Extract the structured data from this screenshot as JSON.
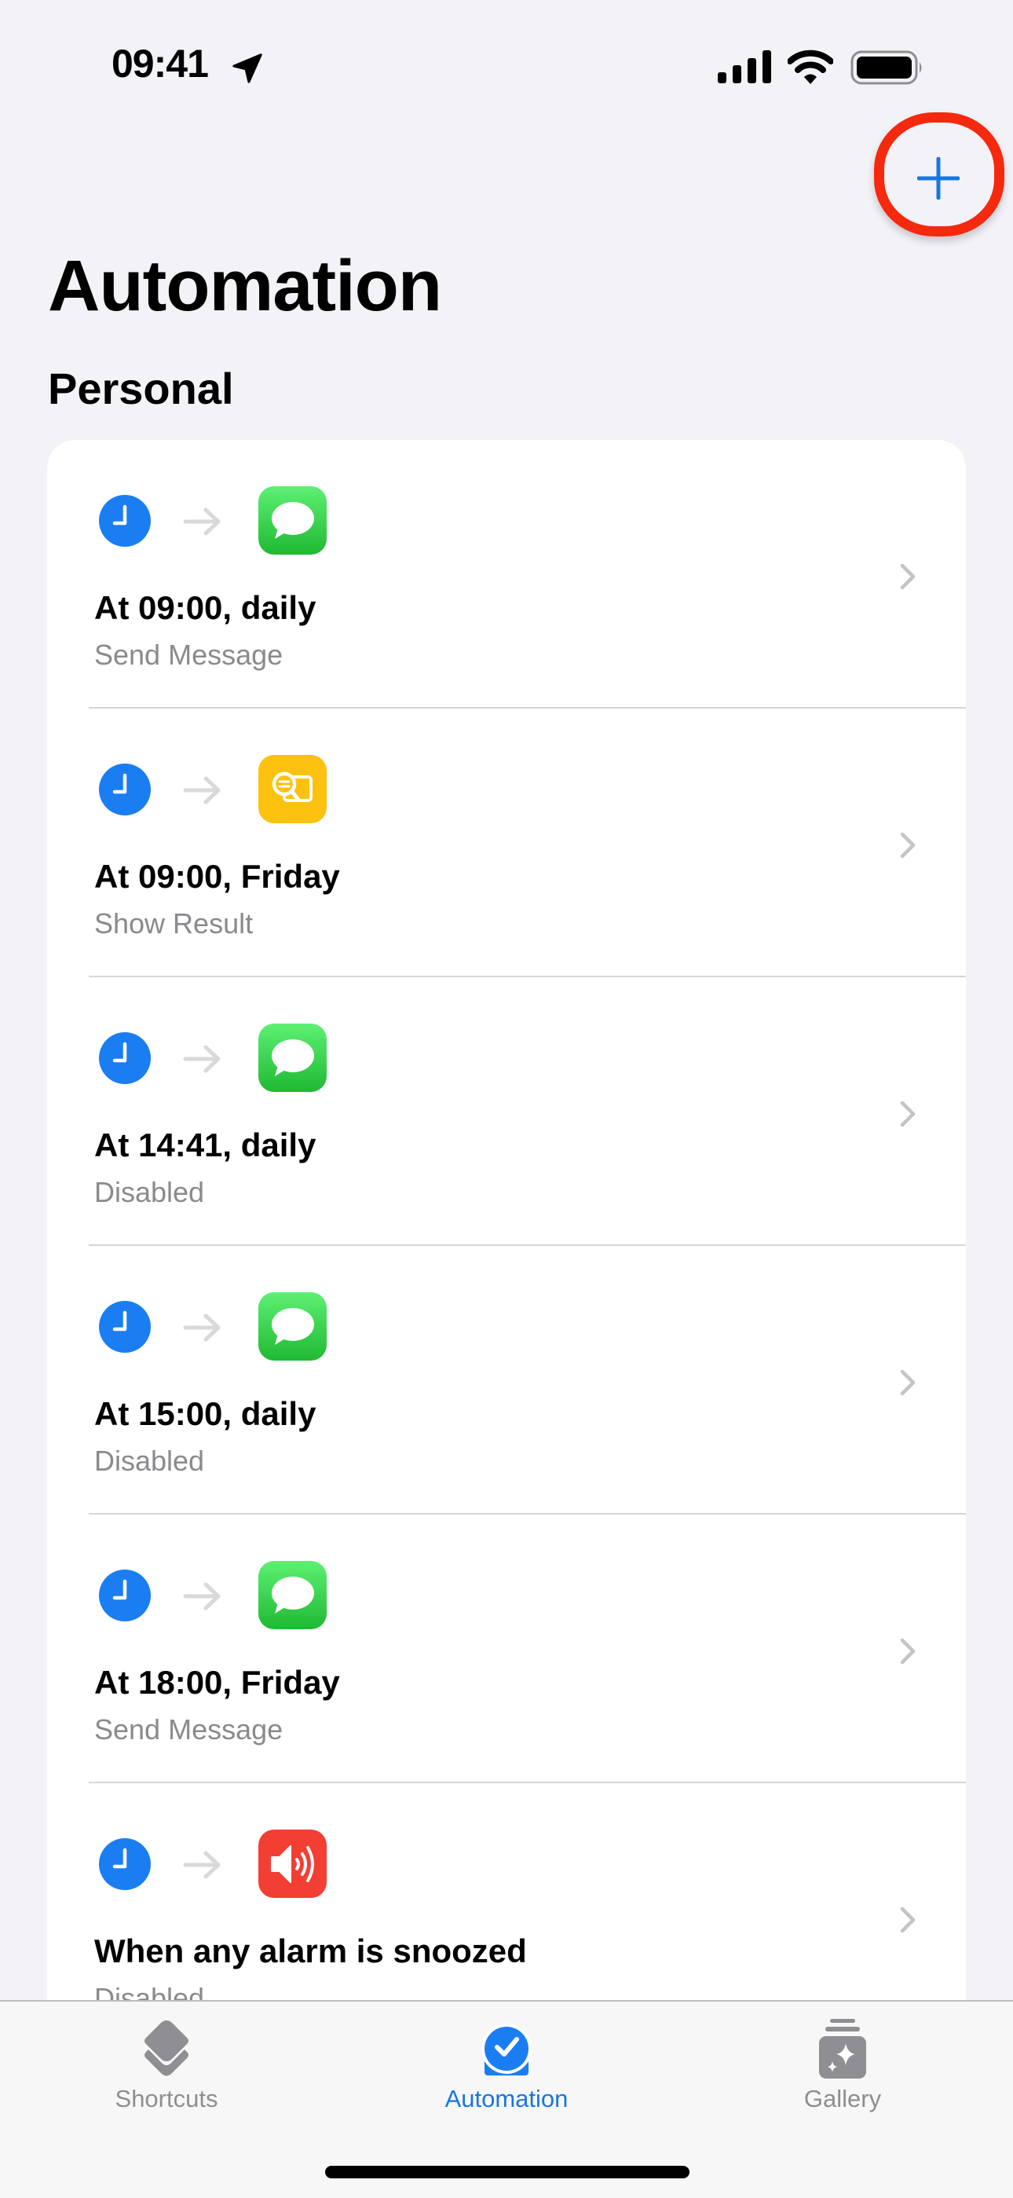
{
  "status_bar": {
    "time": "09:41",
    "icons": [
      "location-arrow-icon",
      "cellular-signal-icon",
      "wifi-icon",
      "battery-icon"
    ]
  },
  "nav": {
    "add_button_icon": "plus-icon",
    "annotation": "red-circle-highlight"
  },
  "page": {
    "title": "Automation",
    "section_title": "Personal"
  },
  "colors": {
    "accent": "#1976E0",
    "clock_blue": "#1A7EF2",
    "messages_green": "#34C759",
    "show_result_yellow": "#FDC20F",
    "sound_red": "#F33E33",
    "annotation_red": "#F5290E",
    "background": "#F2F2F7"
  },
  "automations": [
    {
      "title": "At 09:00, daily",
      "subtitle": "Send Message",
      "trigger_icon": "clock-icon",
      "action_icon": "messages-icon"
    },
    {
      "title": "At 09:00, Friday",
      "subtitle": "Show Result",
      "trigger_icon": "clock-icon",
      "action_icon": "show-result-icon"
    },
    {
      "title": "At 14:41, daily",
      "subtitle": "Disabled",
      "trigger_icon": "clock-icon",
      "action_icon": "messages-icon"
    },
    {
      "title": "At 15:00, daily",
      "subtitle": "Disabled",
      "trigger_icon": "clock-icon",
      "action_icon": "messages-icon"
    },
    {
      "title": "At 18:00, Friday",
      "subtitle": "Send Message",
      "trigger_icon": "clock-icon",
      "action_icon": "messages-icon"
    },
    {
      "title": "When any alarm is snoozed",
      "subtitle": "Disabled",
      "trigger_icon": "clock-icon",
      "action_icon": "speaker-icon"
    }
  ],
  "tab_bar": {
    "tabs": [
      {
        "label": "Shortcuts",
        "icon": "shortcuts-stack-icon",
        "active": false
      },
      {
        "label": "Automation",
        "icon": "automation-check-icon",
        "active": true
      },
      {
        "label": "Gallery",
        "icon": "gallery-sparkle-icon",
        "active": false
      }
    ]
  }
}
